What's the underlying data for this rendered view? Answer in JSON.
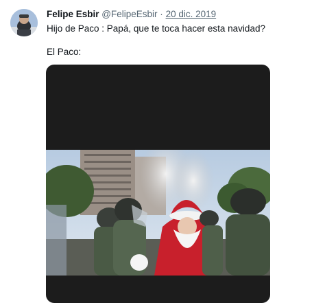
{
  "tweet": {
    "author_name": "Felipe Esbir",
    "handle": "@FelipeEsbir",
    "separator": "·",
    "date": "20 dic. 2019",
    "line1": "Hijo de Paco : Papá, que te toca hacer esta navidad?",
    "line2": "El Paco:"
  },
  "colors": {
    "text_primary": "#0f1419",
    "text_secondary": "#536471",
    "media_background": "#1c1c1c"
  }
}
